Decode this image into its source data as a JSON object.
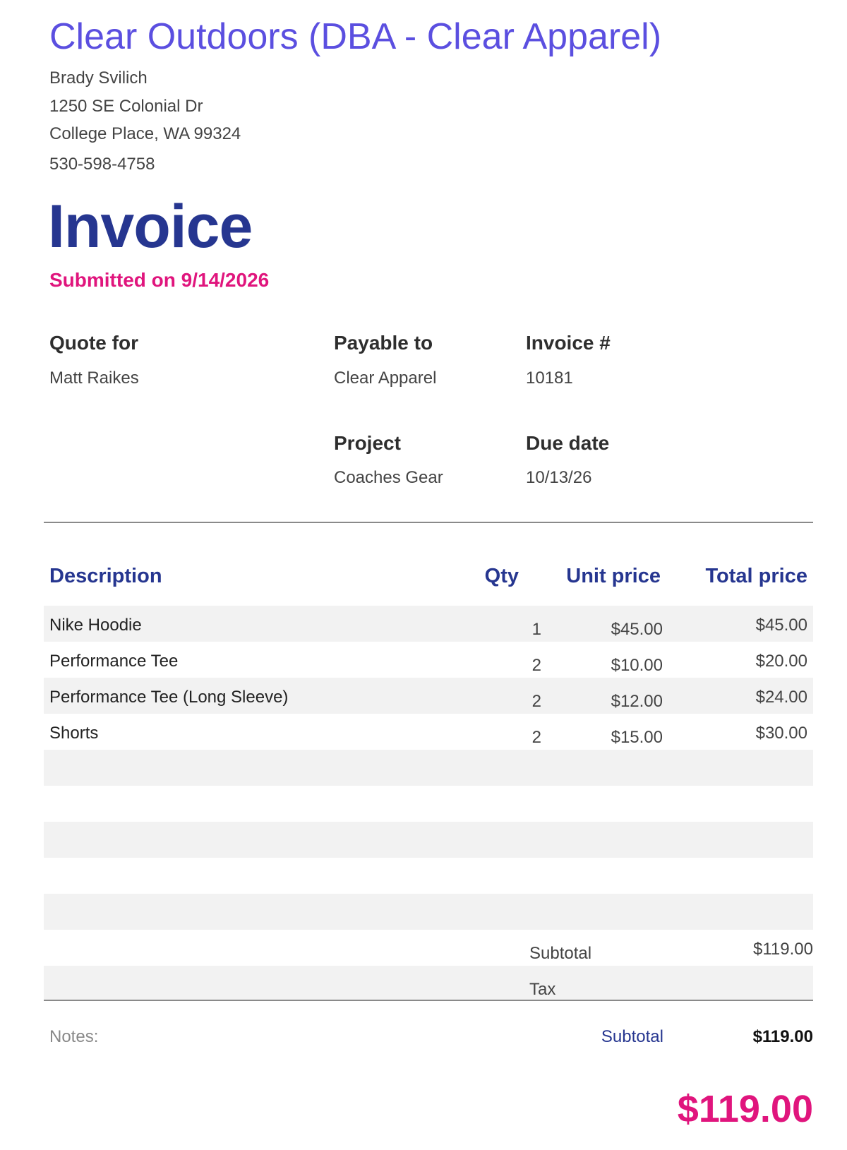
{
  "company": {
    "name": "Clear Outdoors (DBA - Clear Apparel)",
    "contact": "Brady Svilich",
    "street": "1250 SE Colonial Dr",
    "city": "College Place, WA 99324",
    "phone": "530-598-4758"
  },
  "title": "Invoice",
  "submitted": "Submitted on 9/14/2026",
  "meta": {
    "quote_for_label": "Quote for",
    "quote_for_value": "Matt Raikes",
    "payable_to_label": "Payable to",
    "payable_to_value": "Clear Apparel",
    "invoice_no_label": "Invoice #",
    "invoice_no_value": "10181",
    "project_label": "Project",
    "project_value": "Coaches Gear",
    "due_date_label": "Due date",
    "due_date_value": "10/13/26"
  },
  "table": {
    "headers": {
      "description": "Description",
      "qty": "Qty",
      "unit_price": "Unit price",
      "total_price": "Total price"
    },
    "rows": [
      {
        "description": "Nike Hoodie",
        "qty": "1",
        "unit_price": "$45.00",
        "total_price": "$45.00"
      },
      {
        "description": "Performance Tee",
        "qty": "2",
        "unit_price": "$10.00",
        "total_price": "$20.00"
      },
      {
        "description": "Performance Tee (Long Sleeve)",
        "qty": "2",
        "unit_price": "$12.00",
        "total_price": "$24.00"
      },
      {
        "description": "Shorts",
        "qty": "2",
        "unit_price": "$15.00",
        "total_price": "$30.00"
      }
    ]
  },
  "summary": {
    "subtotal_label": "Subtotal",
    "subtotal_value": "$119.00",
    "tax_label": "Tax",
    "tax_value": ""
  },
  "footer": {
    "notes_label": "Notes:",
    "subtotal_label": "Subtotal",
    "subtotal_value": "$119.00",
    "grand_total": "$119.00"
  },
  "colors": {
    "company": "#5b4fe0",
    "title": "#263690",
    "accent": "#e0157d",
    "row_shade": "#f2f2f2"
  }
}
